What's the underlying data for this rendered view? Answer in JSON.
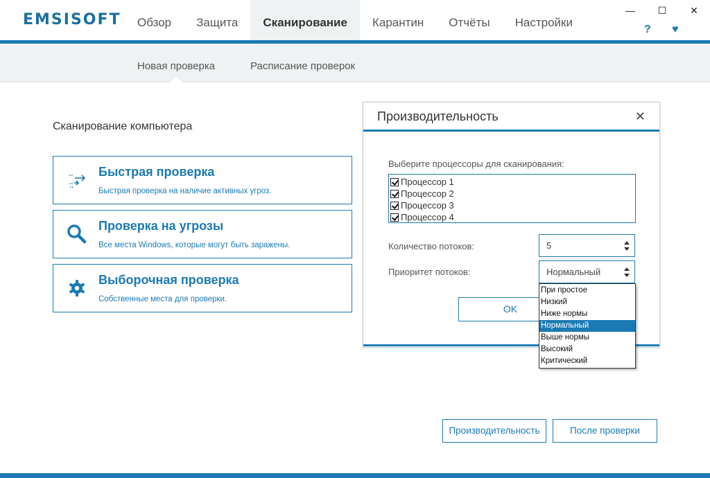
{
  "app": {
    "logo": "EMSISOFT",
    "nav": [
      "Обзор",
      "Защита",
      "Сканирование",
      "Карантин",
      "Отчёты",
      "Настройки"
    ],
    "nav_active_index": 2,
    "window_controls": {
      "minimize": "—",
      "maximize": "☐",
      "close": "✕"
    },
    "help_icon": "?",
    "heart_icon": "♥"
  },
  "subnav": {
    "items": [
      "Новая проверка",
      "Расписание проверок"
    ],
    "active_index": 0
  },
  "scan": {
    "section_title": "Сканирование компьютера",
    "cards": [
      {
        "title": "Быстрая проверка",
        "desc": "Быстрая проверка на наличие активных угроз.",
        "icon": "quick-scan-arrows-icon"
      },
      {
        "title": "Проверка на угрозы",
        "desc": "Все места Windows, которые могут быть заражены.",
        "icon": "magnifier-icon"
      },
      {
        "title": "Выборочная проверка",
        "desc": "Собственные места для проверки.",
        "icon": "gear-icon"
      }
    ]
  },
  "dialog": {
    "title": "Производительность",
    "close_label": "✕",
    "cpu_label": "Выберите процессоры для сканирования:",
    "cpus": [
      "Процессор 1",
      "Процессор 2",
      "Процессор 3",
      "Процессор 4"
    ],
    "threads_label": "Количество потоков:",
    "threads_value": "5",
    "priority_label": "Приоритет потоков:",
    "priority_value": "Нормальный",
    "ok_label": "OK"
  },
  "priority_dropdown": {
    "options": [
      "При простое",
      "Низкий",
      "Ниже нормы",
      "Нормальный",
      "Выше нормы",
      "Высокий",
      "Критический"
    ],
    "selected_index": 3
  },
  "bottom": {
    "performance_label": "Производительность",
    "after_scan_label": "После проверки"
  },
  "colors": {
    "accent": "#1b7ab3",
    "subnav_bg": "#eef2f3"
  }
}
